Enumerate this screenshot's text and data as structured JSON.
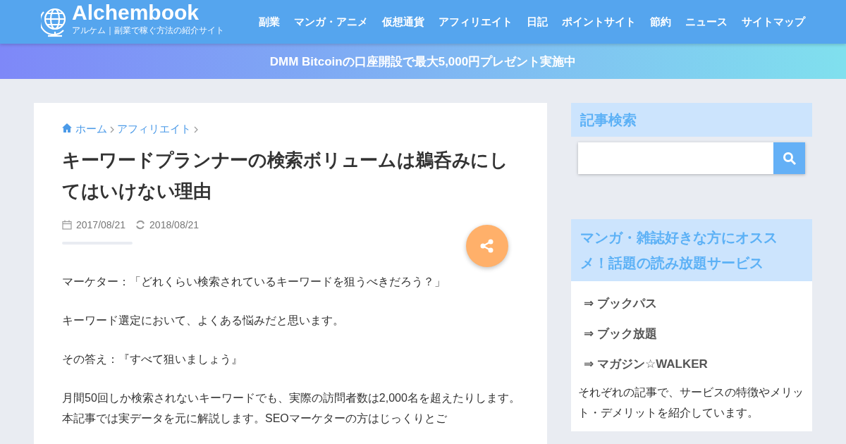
{
  "header": {
    "logo": "Alchembook",
    "tagline": "アルケム｜副業で稼ぐ方法の紹介サイト",
    "nav": [
      "副業",
      "マンガ・アニメ",
      "仮想通貨",
      "アフィリエイト",
      "日記",
      "ポイントサイト",
      "節約",
      "ニュース",
      "サイトマップ"
    ]
  },
  "banner": {
    "text": "DMM Bitcoinの口座開設で最大5,000円プレゼント実施中"
  },
  "article": {
    "breadcrumbs": [
      "ホーム",
      "アフィリエイト"
    ],
    "title": "キーワードプランナーの検索ボリュームは鵜呑みにしてはいけない理由",
    "published": "2017/08/21",
    "updated": "2018/08/21",
    "paragraphs": [
      "マーケター：「どれくらい検索されているキーワードを狙うべきだろう？」",
      "キーワード選定において、よくある悩みだと思います。",
      "その答え：『すべて狙いましょう』",
      "月間50回しか検索されないキーワードでも、実際の訪問者数は2,000名を超えたりします。本記事では実データを元に解説します。SEOマーケターの方はじっくりとご"
    ]
  },
  "sidebar": {
    "search": {
      "title": "記事検索"
    },
    "manga": {
      "title": "マンガ・雑誌好きな方にオススメ！話題の読み放題サービス",
      "links": [
        "⇒ ブックパス",
        "⇒ ブック放題",
        "⇒ マガジン☆WALKER"
      ],
      "note": "それぞれの記事で、サービスの特徴やメリット・デメリットを紹介しています。"
    }
  }
}
